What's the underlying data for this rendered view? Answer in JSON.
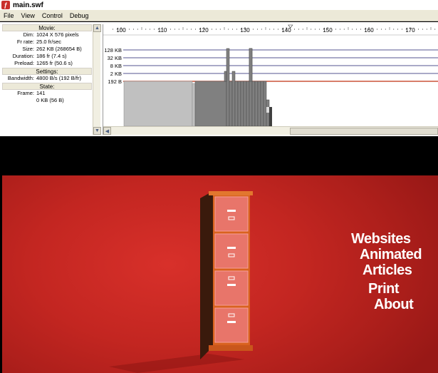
{
  "window": {
    "title": "main.swf"
  },
  "menu": [
    "File",
    "View",
    "Control",
    "Debug"
  ],
  "profiler": {
    "movie_header": "Movie:",
    "movie": [
      {
        "k": "Dim:",
        "v": "1024 X 576 pixels"
      },
      {
        "k": "Fr rate:",
        "v": "25.0 fr/sec"
      },
      {
        "k": "Size:",
        "v": "262 KB (268654 B)"
      },
      {
        "k": "Duration:",
        "v": "186 fr (7.4 s)"
      },
      {
        "k": "Preload:",
        "v": "1265 fr (50.6 s)"
      }
    ],
    "settings_header": "Settings:",
    "bandwidth": {
      "k": "Bandwidth:",
      "v": "4800 B/s (192 B/fr)"
    },
    "state_header": "State:",
    "frame": {
      "k": "Frame:",
      "v": "141"
    },
    "frame_size": "0 KB (56 B)"
  },
  "timeline": {
    "ruler_labels": [
      "100",
      "110",
      "120",
      "130",
      "140",
      "150",
      "160",
      "170"
    ],
    "y_labels": [
      "128 KB",
      "32 KB",
      "8 KB",
      "2 KB",
      "192 B"
    ],
    "current_frame": 141,
    "colors": {
      "light_bar": "#c0c0c0",
      "mid_bar": "#808080",
      "dark_bar": "#404040",
      "limit_line": "#c03010",
      "grid": "#1c1c6c"
    }
  },
  "stage": {
    "background": "#c32621",
    "nav": [
      "Websites",
      "Animated",
      "Articles",
      "Print",
      "About"
    ]
  }
}
